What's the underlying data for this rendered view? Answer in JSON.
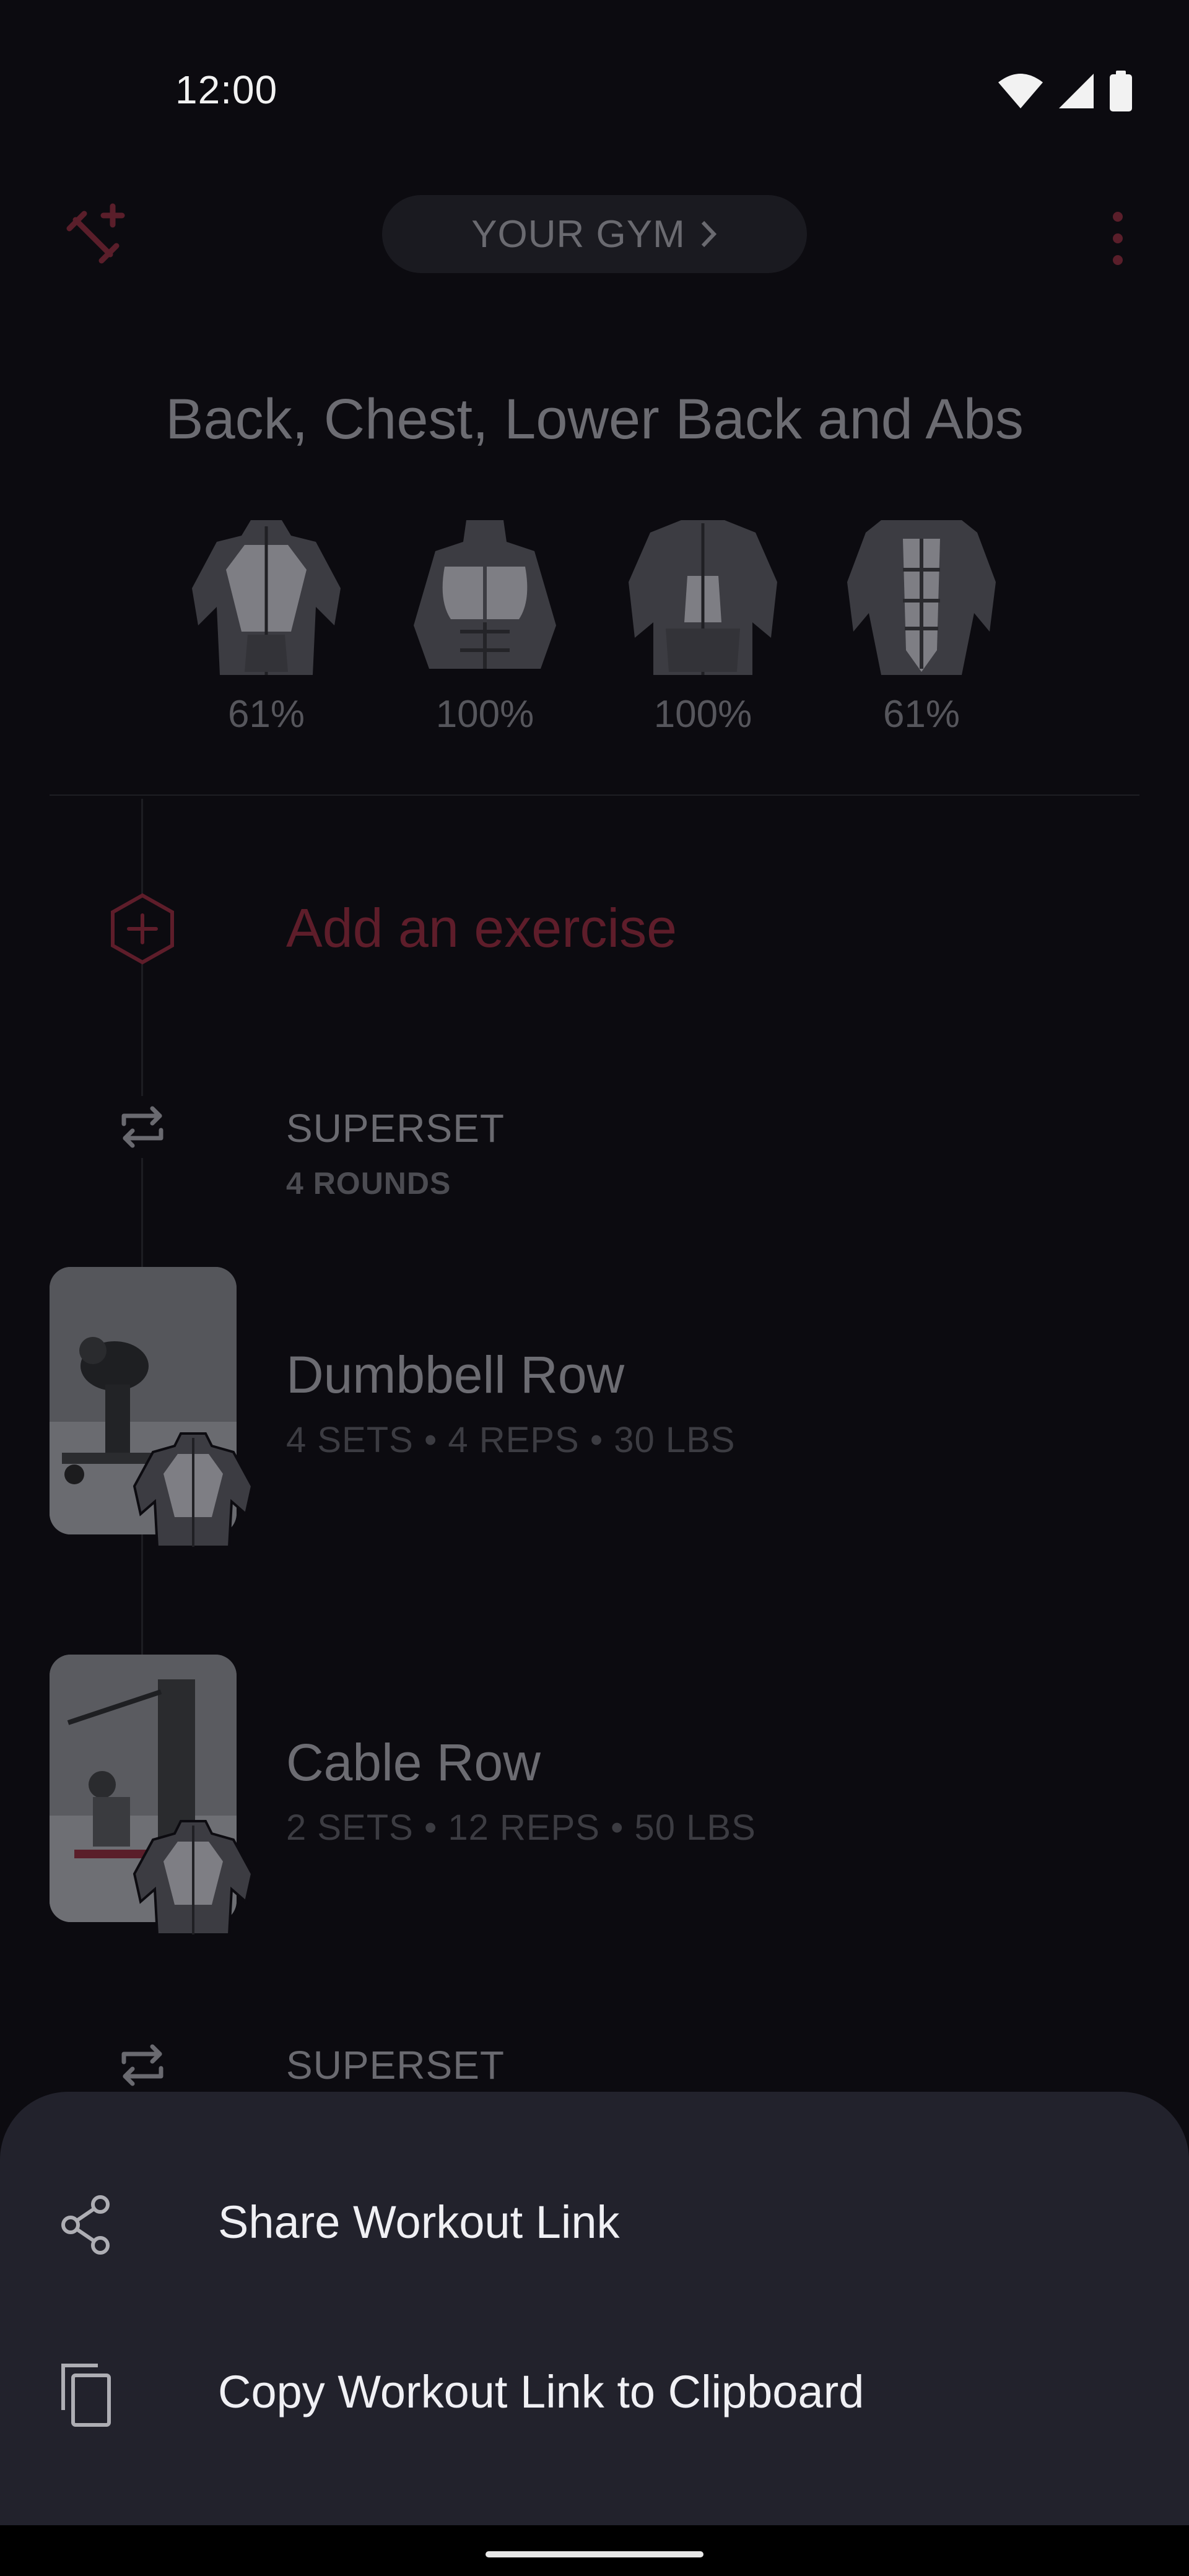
{
  "status_bar": {
    "time": "12:00",
    "icons": [
      "wifi-icon",
      "cell-signal-icon",
      "battery-icon"
    ]
  },
  "header": {
    "logo_icon": "dumbbell-plus-icon",
    "gym_label": "YOUR GYM",
    "gym_chevron_icon": "chevron-right-icon",
    "more_icon": "more-vertical-icon"
  },
  "workout": {
    "title": "Back, Chest, Lower Back and Abs",
    "muscles": [
      {
        "name": "back-muscle-icon",
        "percent": "61%"
      },
      {
        "name": "chest-muscle-icon",
        "percent": "100%"
      },
      {
        "name": "lower-back-muscle-icon",
        "percent": "100%"
      },
      {
        "name": "abs-muscle-icon",
        "percent": "61%"
      }
    ]
  },
  "add_exercise": {
    "label": "Add an exercise",
    "icon": "add-hexagon-icon"
  },
  "supersets": [
    {
      "title": "SUPERSET",
      "rounds": "4 ROUNDS",
      "icon": "repeat-icon"
    },
    {
      "title": "SUPERSET",
      "icon": "repeat-icon"
    }
  ],
  "exercises": [
    {
      "name": "Dumbbell Row",
      "details": "4 SETS • 4 REPS • 30 LBS"
    },
    {
      "name": "Cable Row",
      "details": "2 SETS • 12 REPS • 50 LBS"
    }
  ],
  "sheet": {
    "items": [
      {
        "label": "Share Workout Link",
        "icon": "share-icon"
      },
      {
        "label": "Copy Workout Link to Clipboard",
        "icon": "copy-icon"
      }
    ]
  },
  "colors": {
    "background": "#0c0b10",
    "sheet": "#22222c",
    "accent_dim": "#5e1d2a",
    "text_primary_sheet": "#f0f0f4"
  }
}
